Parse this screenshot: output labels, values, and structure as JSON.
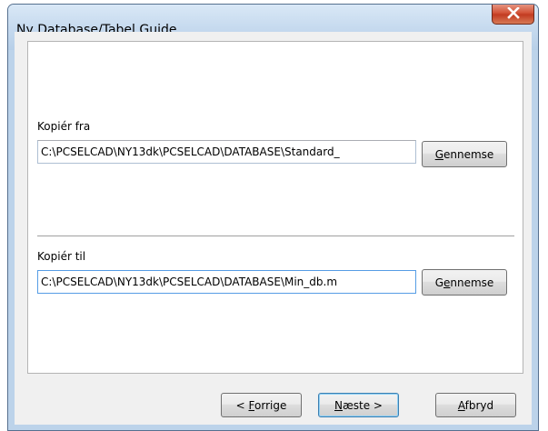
{
  "window": {
    "title": "Ny Database/Tabel Guide"
  },
  "copy_from": {
    "label": "Kopiér fra",
    "path": "C:\\PCSELCAD\\NY13dk\\PCSELCAD\\DATABASE\\Standard_",
    "browse_mnemonic": "G",
    "browse_rest": "ennemse"
  },
  "copy_to": {
    "label": "Kopiér til",
    "path": "C:\\PCSELCAD\\NY13dk\\PCSELCAD\\DATABASE\\Min_db.m",
    "browse_pre": "G",
    "browse_mnemonic": "e",
    "browse_rest": "nnemse"
  },
  "footer": {
    "back_pre": "< ",
    "back_mnemonic": "F",
    "back_rest": "orrige",
    "next_mnemonic": "N",
    "next_rest": "æste >",
    "cancel_mnemonic": "A",
    "cancel_rest": "fbryd"
  }
}
